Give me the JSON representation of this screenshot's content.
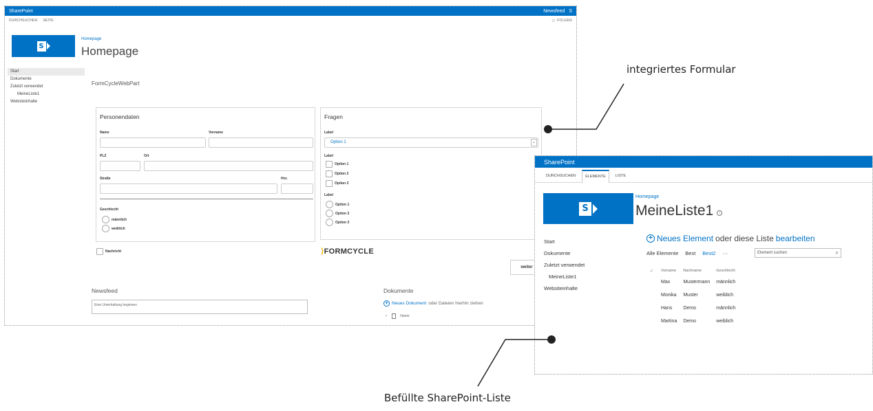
{
  "screenshot1": {
    "suite_bar": {
      "app": "SharePoint",
      "right_items": [
        "Newsfeed",
        "S"
      ]
    },
    "ribbon": {
      "tabs": [
        "DURCHSUCHEN",
        "SEITE"
      ],
      "follow": "FOLGEN"
    },
    "breadcrumb": "Homepage",
    "page_title": "Homepage",
    "quick_launch": [
      {
        "label": "Start",
        "selected": true
      },
      {
        "label": "Dokumente"
      },
      {
        "label": "Zuletzt verwendet"
      },
      {
        "label": "MeineListe1",
        "sub": true
      },
      {
        "label": "Websiteinhalte"
      }
    ],
    "webpart_title": "FormCycleWebPart",
    "form": {
      "personen": {
        "heading": "Personendaten",
        "name": "Name",
        "vorname": "Vorname",
        "plz": "PLZ",
        "ort": "Ort",
        "strasse": "Straße",
        "hnr": "Hnr.",
        "geschlecht": "Geschlecht",
        "radios": [
          "männlich",
          "weiblich"
        ]
      },
      "fragen": {
        "heading": "Fragen",
        "label1": "Label",
        "select_value": "Option 1",
        "label2": "Label",
        "checks": [
          "Option 1",
          "Option 2",
          "Option 3"
        ],
        "label3": "Label",
        "radios": [
          "Option 1",
          "Option 2",
          "Option 3"
        ]
      },
      "nachricht": "Nachricht",
      "brand": "FORMCYCLE",
      "weiter": "weiter"
    },
    "newsfeed": {
      "heading": "Newsfeed",
      "placeholder": "Eine Unterhaltung beginnen"
    },
    "dokumente": {
      "heading": "Dokumente",
      "new_link": "Neues Dokument",
      "rest": "oder Dateien hierhin ziehen",
      "col_name": "Name"
    }
  },
  "screenshot2": {
    "suite_bar": {
      "app": "SharePoint"
    },
    "ribbon": {
      "tabs": [
        "DURCHSUCHEN",
        "ELEMENTE",
        "LISTE"
      ],
      "active_tab": "ELEMENTE"
    },
    "breadcrumb": "Homepage",
    "page_title": "MeineListe1",
    "quick_launch": [
      {
        "label": "Start"
      },
      {
        "label": "Dokumente"
      },
      {
        "label": "Zuletzt verwendet"
      },
      {
        "label": "MeineListe1",
        "sub": true
      },
      {
        "label": "Websiteinhalte"
      }
    ],
    "new_item": {
      "link": "Neues Element",
      "middle": "oder diese Liste",
      "edit": "bearbeiten"
    },
    "views": {
      "items": [
        "Alle Elemente",
        "Best",
        "Best2"
      ],
      "active": "Best2",
      "more": "···"
    },
    "search_placeholder": "Element suchen",
    "table": {
      "columns": [
        "Vorname",
        "Nachname",
        "Geschlecht"
      ],
      "rows": [
        [
          "Max",
          "Mustermann",
          "männlich"
        ],
        [
          "Monika",
          "Muster",
          "weiblich"
        ],
        [
          "Hans",
          "Demo",
          "männlich"
        ],
        [
          "Martina",
          "Demo",
          "weiblich"
        ]
      ]
    }
  },
  "annotations": {
    "top": "integriertes Formular",
    "bottom": "Befüllte SharePoint-Liste"
  },
  "colors": {
    "sharepoint_blue": "#0072c6",
    "formcycle_accent": "#f6b400"
  },
  "icons": [
    "sharepoint-logo-icon",
    "star-icon",
    "plus-circle-icon",
    "document-icon",
    "search-icon",
    "info-icon",
    "checkmark-icon"
  ]
}
